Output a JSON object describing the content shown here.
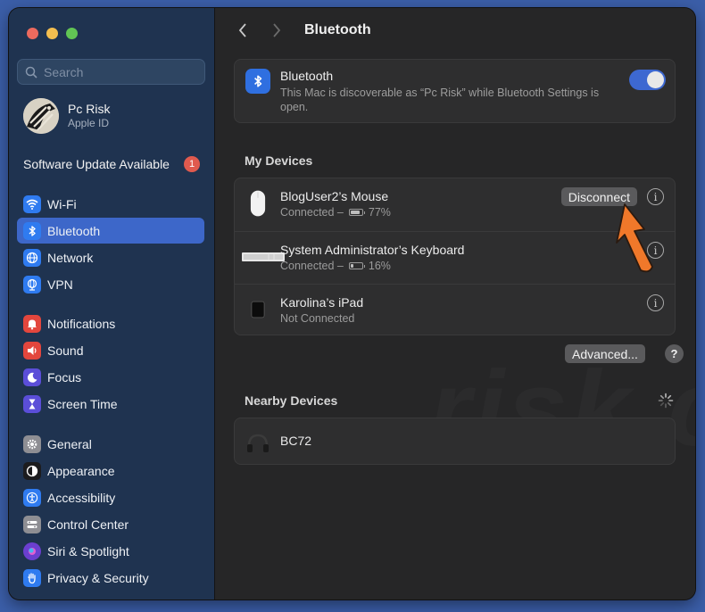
{
  "sidebar": {
    "search_placeholder": "Search",
    "account": {
      "name": "Pc Risk",
      "subtitle": "Apple ID"
    },
    "software_update": {
      "label": "Software Update Available",
      "badge": "1"
    },
    "items": [
      {
        "label": "Wi-Fi",
        "icon": "wifi-icon",
        "color": "#2f7bf0"
      },
      {
        "label": "Bluetooth",
        "icon": "bluetooth-icon",
        "color": "#2f7bf0",
        "selected": true
      },
      {
        "label": "Network",
        "icon": "globe-icon",
        "color": "#2f7bf0"
      },
      {
        "label": "VPN",
        "icon": "vpn-globe-icon",
        "color": "#2f7bf0"
      },
      {
        "label": "Notifications",
        "icon": "bell-icon",
        "color": "#e3463d"
      },
      {
        "label": "Sound",
        "icon": "speaker-icon",
        "color": "#e3463d"
      },
      {
        "label": "Focus",
        "icon": "moon-icon",
        "color": "#5b4ed8"
      },
      {
        "label": "Screen Time",
        "icon": "hourglass-icon",
        "color": "#5b4ed8"
      },
      {
        "label": "General",
        "icon": "gear-icon",
        "color": "#8e8e93"
      },
      {
        "label": "Appearance",
        "icon": "appearance-icon",
        "color": "#1c1c1e"
      },
      {
        "label": "Accessibility",
        "icon": "accessibility-icon",
        "color": "#2f7bf0"
      },
      {
        "label": "Control Center",
        "icon": "control-center-icon",
        "color": "#8e8e93"
      },
      {
        "label": "Siri & Spotlight",
        "icon": "siri-icon",
        "color": "#6b3fd0"
      },
      {
        "label": "Privacy & Security",
        "icon": "hand-icon",
        "color": "#2f7bf0"
      }
    ]
  },
  "header": {
    "title": "Bluetooth"
  },
  "bluetooth": {
    "title": "Bluetooth",
    "description": "This Mac is discoverable as “Pc Risk” while Bluetooth Settings is open.",
    "enabled": true
  },
  "my_devices": {
    "title": "My Devices",
    "devices": [
      {
        "name": "BlogUser2’s Mouse",
        "status": "Connected –",
        "battery": "77%",
        "battery_level": 0.77,
        "action": "Disconnect",
        "icon": "mouse-icon"
      },
      {
        "name": "System Administrator’s Keyboard",
        "status": "Connected –",
        "battery": "16%",
        "battery_level": 0.16,
        "icon": "keyboard-icon"
      },
      {
        "name": "Karolina’s iPad",
        "status": "Not Connected",
        "icon": "ipad-icon"
      }
    ],
    "advanced_label": "Advanced...",
    "help_label": "?"
  },
  "nearby_devices": {
    "title": "Nearby Devices",
    "devices": [
      {
        "name": "BC72",
        "icon": "headphones-icon"
      }
    ]
  },
  "watermark": "risk.com"
}
